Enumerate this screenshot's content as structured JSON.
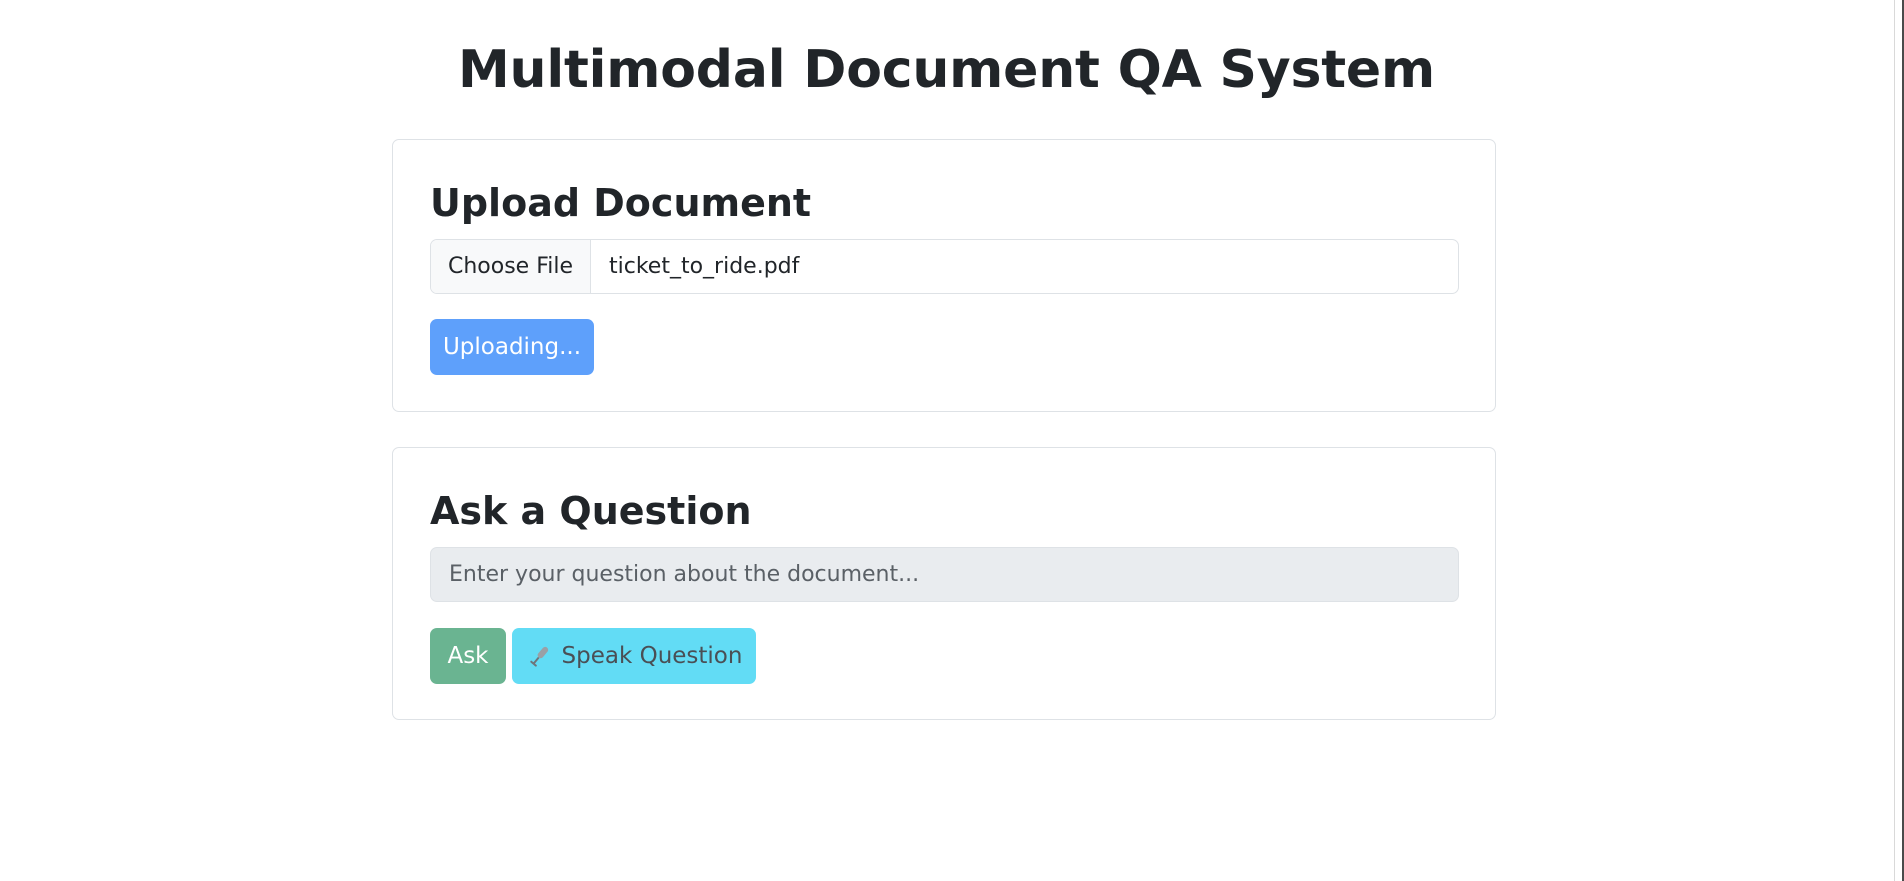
{
  "page": {
    "title": "Multimodal Document QA System"
  },
  "upload_section": {
    "heading": "Upload Document",
    "choose_file_label": "Choose File",
    "file_name": "ticket_to_ride.pdf",
    "upload_button_label": "Uploading..."
  },
  "question_section": {
    "heading": "Ask a Question",
    "question_placeholder": "Enter your question about the document...",
    "question_value": "",
    "ask_button_label": "Ask",
    "speak_button_label": "Speak Question",
    "speak_icon": "microphone-icon"
  },
  "colors": {
    "upload_button": "#5ea0fb",
    "ask_button": "#6ab491",
    "speak_button": "#62dcf5",
    "input_disabled_bg": "#e9ecef"
  }
}
